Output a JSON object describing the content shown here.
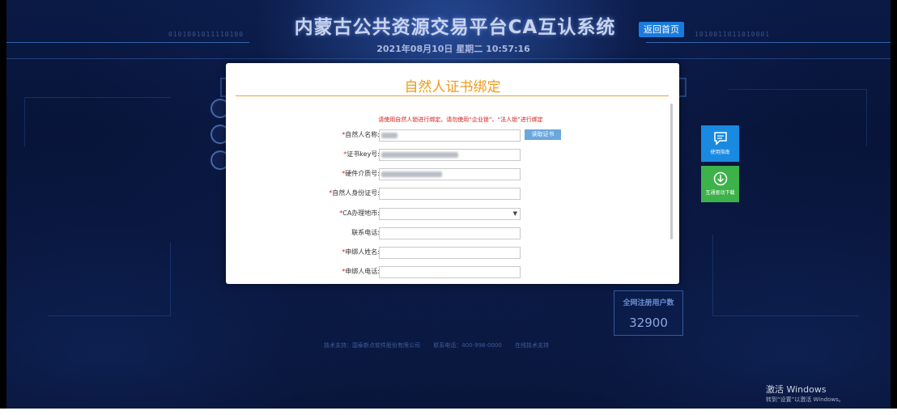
{
  "header": {
    "title": "内蒙古公共资源交易平台CA互认系统",
    "datetime": "2021年08月10日 星期二 10:57:16",
    "home_button": "返回首页",
    "binary_left": "0101001011110100",
    "binary_right": "1010011011010001"
  },
  "modal": {
    "title": "自然人证书绑定",
    "notice": "请使用自然人锁进行绑定。请勿使用“企业锁”、“法人锁”进行绑定",
    "read_cert_button": "读取证书",
    "fields": [
      {
        "label": "自然人名称:",
        "required": true,
        "value": ""
      },
      {
        "label": "证书key号:",
        "required": true,
        "value": ""
      },
      {
        "label": "硬件介质号:",
        "required": true,
        "value": ""
      },
      {
        "label": "自然人身份证号:",
        "required": true,
        "value": ""
      },
      {
        "label": "CA办理地市:",
        "required": true,
        "value": ""
      },
      {
        "label": "联系电话:",
        "required": false,
        "value": ""
      },
      {
        "label": "申绑人姓名:",
        "required": true,
        "value": ""
      },
      {
        "label": "申绑人电话:",
        "required": true,
        "value": ""
      }
    ]
  },
  "side_tiles": {
    "guide": "使用指南",
    "driver": "互通驱动下载"
  },
  "stats": {
    "label": "全网注册用户数",
    "count": "32900"
  },
  "footer": {
    "support": "技术支持：国泰新点软件股份有限公司",
    "phone": "联系电话：400-998-0000",
    "online": "在线技术支持"
  },
  "watermark": {
    "line1": "激活 Windows",
    "line2": "转到“设置”以激活 Windows。"
  },
  "colors": {
    "accent_orange": "#f09a1b",
    "button_blue": "#1b7bdc",
    "tile_blue": "#1a8ae0",
    "tile_green": "#3db24a",
    "notice_red": "#d31919"
  }
}
